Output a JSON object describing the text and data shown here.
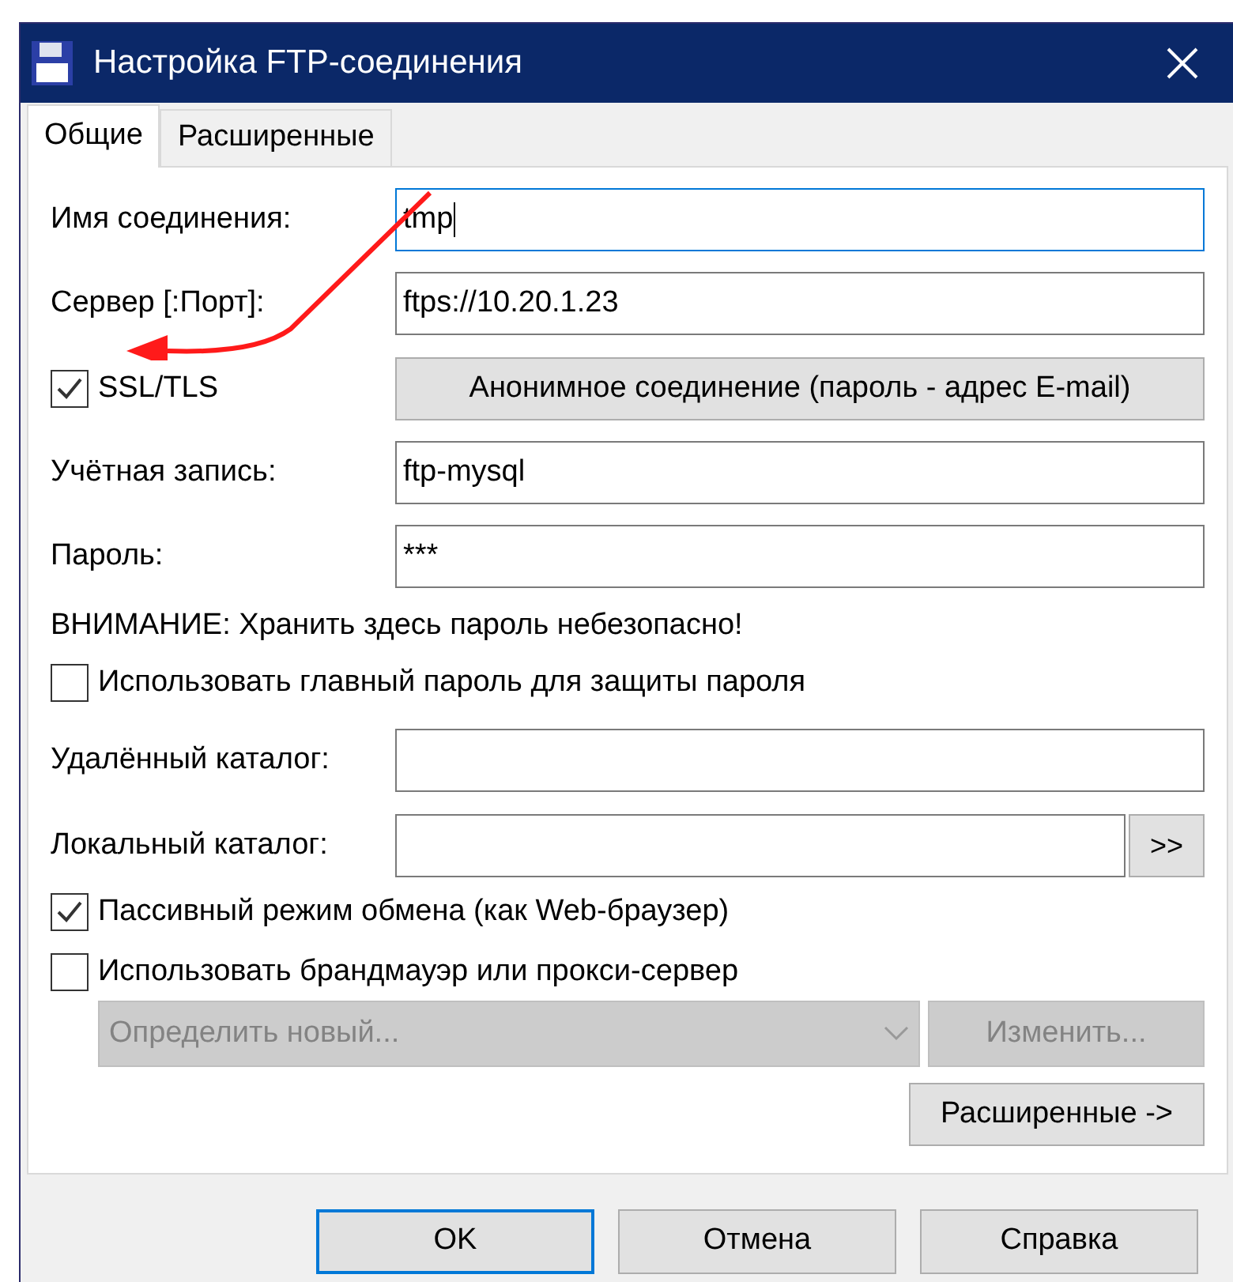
{
  "window": {
    "title": "Настройка FTP-соединения"
  },
  "tabs": [
    {
      "label": "Общие",
      "selected": true
    },
    {
      "label": "Расширенные",
      "selected": false
    }
  ],
  "rows": [
    {
      "kind": "field",
      "label": "Имя соединения:",
      "value": "tmp",
      "focused": true
    },
    {
      "kind": "field",
      "label": "Сервер [:Порт]:",
      "value": "ftps://10.20.1.23",
      "focused": false
    },
    {
      "kind": "checkbox_button",
      "label": "SSL/TLS",
      "checked": true,
      "button": "Анонимное соединение (пароль - адрес E-mail)"
    },
    {
      "kind": "field",
      "label": "Учётная запись:",
      "value": "ftp-mysql",
      "focused": false
    },
    {
      "kind": "field",
      "label": "Пароль:",
      "value": "***",
      "focused": false
    },
    {
      "kind": "note",
      "text": "ВНИМАНИЕ: Хранить здесь пароль небезопасно!"
    },
    {
      "kind": "checkbox",
      "label": "Использовать главный пароль для защиты пароля",
      "checked": false
    },
    {
      "kind": "field",
      "label": "Удалённый каталог:",
      "value": "",
      "focused": false
    },
    {
      "kind": "browse_field",
      "label": "Локальный каталог:",
      "value": "",
      "button": ">>"
    },
    {
      "kind": "checkbox",
      "label": "Пассивный режим обмена (как Web-браузер)",
      "checked": true
    },
    {
      "kind": "checkbox",
      "label": "Использовать брандмауэр или прокси-сервер",
      "checked": false
    },
    {
      "kind": "proxy",
      "value": "Определить новый...",
      "button": "Изменить...",
      "disabled": true
    },
    {
      "kind": "right_button",
      "button": "Расширенные ->"
    }
  ],
  "buttons": [
    {
      "label": "OK",
      "default": true
    },
    {
      "label": "Отмена",
      "default": false
    },
    {
      "label": "Справка",
      "default": false
    }
  ]
}
